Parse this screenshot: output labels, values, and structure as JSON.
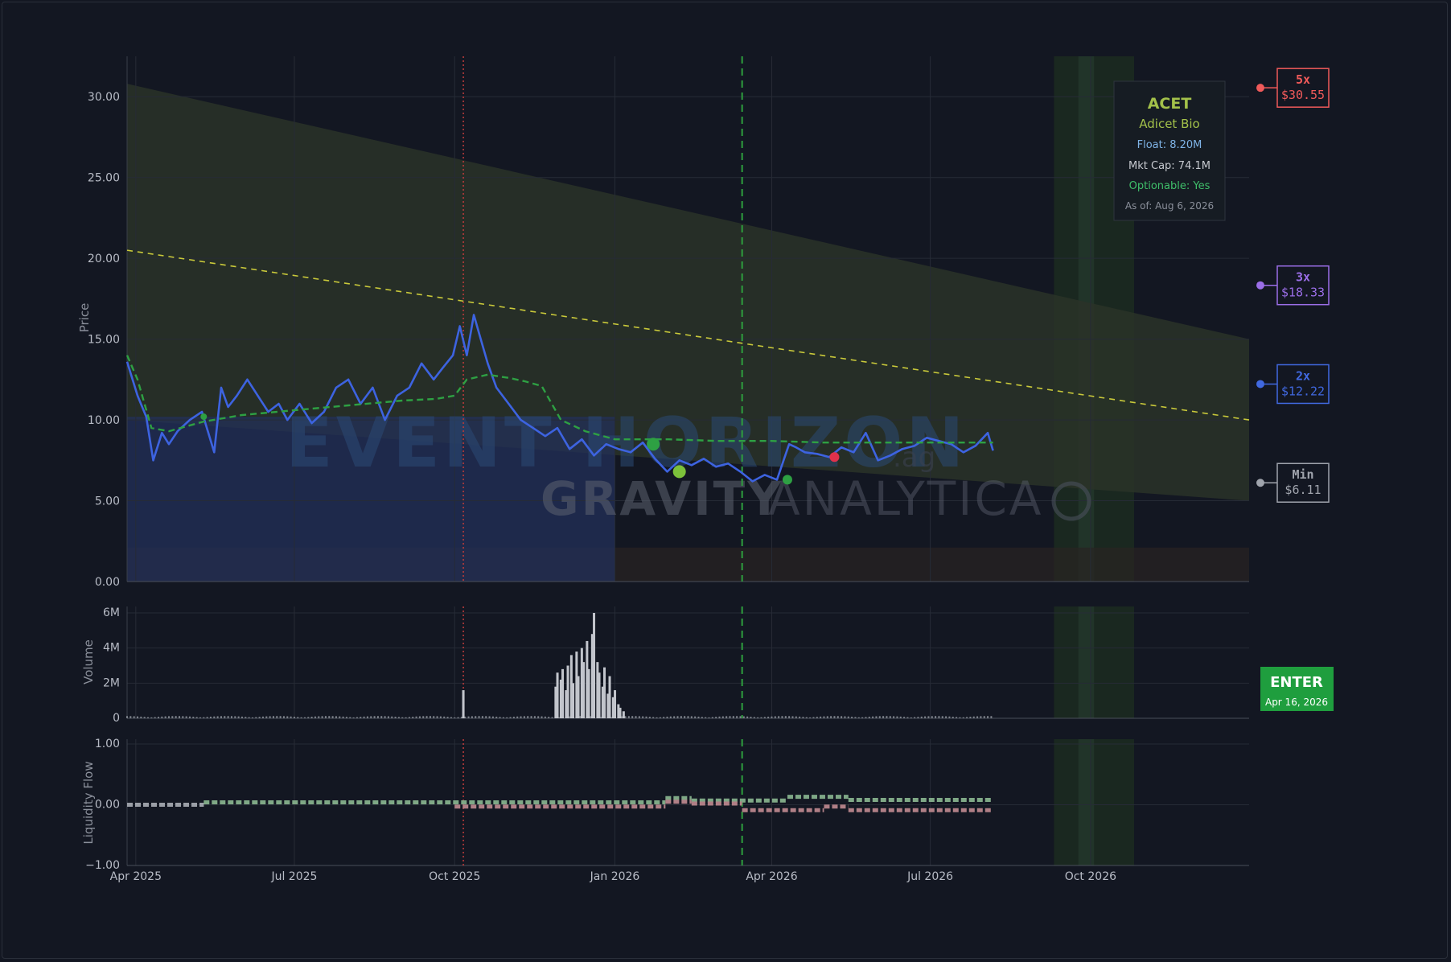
{
  "chart_data": {
    "type": "line",
    "ticker": "ACET",
    "company": "Adicet Bio",
    "float_label": "Float: 8.20M",
    "mktcap_label": "Mkt Cap: 74.1M",
    "optionable_label": "Optionable: Yes",
    "asof_label": "As of: Aug 6, 2026",
    "watermark": {
      "line1": "EVENT HORIZON",
      "suffix": ".ag",
      "line2a": "GRAVITY",
      "line2b": "ANALYTICA"
    },
    "x_ticks": [
      "Apr 2025",
      "Jul 2025",
      "Oct 2025",
      "Jan 2026",
      "Apr 2026",
      "Jul 2026",
      "Oct 2026"
    ],
    "x_range": [
      "2025-03-27",
      "2026-12-31"
    ],
    "price_panel": {
      "ylabel": "Price",
      "ylim": [
        0,
        32.5
      ],
      "yticks": [
        "0.00",
        "5.00",
        "10.00",
        "15.00",
        "20.00",
        "25.00",
        "30.00"
      ],
      "price_dates": [
        "2025-03-27",
        "2025-04-02",
        "2025-04-07",
        "2025-04-11",
        "2025-04-16",
        "2025-04-20",
        "2025-04-25",
        "2025-05-02",
        "2025-05-09",
        "2025-05-16",
        "2025-05-20",
        "2025-05-24",
        "2025-05-29",
        "2025-06-04",
        "2025-06-10",
        "2025-06-16",
        "2025-06-22",
        "2025-06-27",
        "2025-07-04",
        "2025-07-11",
        "2025-07-18",
        "2025-07-25",
        "2025-08-01",
        "2025-08-08",
        "2025-08-15",
        "2025-08-22",
        "2025-08-29",
        "2025-09-05",
        "2025-09-12",
        "2025-09-19",
        "2025-09-24",
        "2025-09-30",
        "2025-10-04",
        "2025-10-08",
        "2025-10-12",
        "2025-10-16",
        "2025-10-20",
        "2025-10-25",
        "2025-11-01",
        "2025-11-08",
        "2025-11-15",
        "2025-11-22",
        "2025-11-29",
        "2025-12-06",
        "2025-12-13",
        "2025-12-20",
        "2025-12-27",
        "2026-01-03",
        "2026-01-10",
        "2026-01-17",
        "2026-01-24",
        "2026-01-31",
        "2026-02-07",
        "2026-02-14",
        "2026-02-21",
        "2026-02-28",
        "2026-03-07",
        "2026-03-14",
        "2026-03-21",
        "2026-03-28",
        "2026-04-04",
        "2026-04-11",
        "2026-04-15",
        "2026-04-20",
        "2026-04-27",
        "2026-05-04",
        "2026-05-11",
        "2026-05-18",
        "2026-05-25",
        "2026-06-01",
        "2026-06-08",
        "2026-06-15",
        "2026-06-22",
        "2026-06-29",
        "2026-07-06",
        "2026-07-13",
        "2026-07-20",
        "2026-07-27",
        "2026-08-03",
        "2026-08-06"
      ],
      "price_values": [
        13.6,
        11.5,
        10.2,
        7.5,
        9.2,
        8.5,
        9.3,
        10.0,
        10.5,
        8.0,
        12.0,
        10.8,
        11.5,
        12.5,
        11.5,
        10.5,
        11.0,
        10.0,
        11.0,
        9.8,
        10.5,
        12.0,
        12.5,
        11.0,
        12.0,
        10.0,
        11.5,
        12.0,
        13.5,
        12.5,
        13.2,
        14.0,
        15.8,
        14.0,
        16.5,
        15.0,
        13.5,
        12.0,
        11.0,
        10.0,
        9.5,
        9.0,
        9.5,
        8.2,
        8.8,
        7.8,
        8.5,
        8.2,
        8.0,
        8.6,
        7.6,
        6.8,
        7.5,
        7.2,
        7.6,
        7.1,
        7.3,
        6.8,
        6.2,
        6.6,
        6.3,
        8.5,
        8.3,
        8.0,
        7.9,
        7.7,
        8.3,
        8.0,
        9.2,
        7.5,
        7.8,
        8.2,
        8.4,
        8.9,
        8.7,
        8.5,
        8.0,
        8.4,
        9.2,
        8.1
      ],
      "ma_dates": [
        "2025-03-27",
        "2025-04-02",
        "2025-04-10",
        "2025-04-20",
        "2025-05-10",
        "2025-06-01",
        "2025-07-01",
        "2025-08-01",
        "2025-09-01",
        "2025-09-20",
        "2025-10-01",
        "2025-10-08",
        "2025-10-20",
        "2025-11-01",
        "2025-11-10",
        "2025-11-20",
        "2025-12-01",
        "2025-12-15",
        "2026-01-01",
        "2026-02-01",
        "2026-03-01",
        "2026-04-01",
        "2026-05-01",
        "2026-06-01",
        "2026-07-01",
        "2026-08-06"
      ],
      "ma_values": [
        14.0,
        12.5,
        9.5,
        9.3,
        9.9,
        10.3,
        10.6,
        10.9,
        11.2,
        11.3,
        11.5,
        12.5,
        12.8,
        12.6,
        12.4,
        12.1,
        10.0,
        9.3,
        8.8,
        8.8,
        8.7,
        8.7,
        8.6,
        8.6,
        8.6,
        8.6
      ],
      "channel": {
        "upper": [
          30.8,
          15.0
        ],
        "lower": [
          10.0,
          5.0
        ],
        "mid": [
          20.5,
          10.0
        ]
      },
      "events": [
        {
          "date": "2025-05-10",
          "y": 10.2,
          "color": "#2ea043"
        },
        {
          "date": "2026-01-23",
          "y": 8.5,
          "color": "#2ea043"
        },
        {
          "date": "2026-02-07",
          "y": 6.8,
          "color": "#7cc13a"
        },
        {
          "date": "2026-04-10",
          "y": 6.3,
          "color": "#2ea043"
        },
        {
          "date": "2026-05-07",
          "y": 7.7,
          "color": "#e0314b"
        }
      ]
    },
    "levels": [
      {
        "label": "5x",
        "value": "$30.55",
        "y": 30.55,
        "color": "#f05a5a"
      },
      {
        "label": "3x",
        "value": "$18.33",
        "y": 18.33,
        "color": "#9b6ee8"
      },
      {
        "label": "2x",
        "value": "$12.22",
        "y": 12.22,
        "color": "#4169e1"
      },
      {
        "label": "Min",
        "value": "$6.11",
        "y": 6.11,
        "color": "#a0a4ad"
      }
    ],
    "volume_panel": {
      "ylabel": "Volume",
      "ylim": [
        0,
        6
      ],
      "yticks": [
        "0",
        "2M",
        "4M",
        "6M"
      ],
      "spike": {
        "date": "2025-10-06",
        "value": 1.6
      },
      "cluster_start": "2025-11-28",
      "cluster_values": [
        1.8,
        2.6,
        2.2,
        2.8,
        1.6,
        3.0,
        3.6,
        2.0,
        3.8,
        2.4,
        4.0,
        3.2,
        4.4,
        2.8,
        4.8,
        6.0,
        3.2,
        2.6,
        1.8,
        2.9,
        1.4,
        2.4,
        1.2,
        1.6,
        0.8,
        0.6,
        0.4
      ]
    },
    "liquidity_panel": {
      "ylabel": "Liquidity Flow",
      "ylim": [
        -1,
        1
      ],
      "yticks": [
        "−1.00",
        "0.00",
        "1.00"
      ],
      "upper_steps": [
        [
          "2025-03-27",
          "2025-05-10",
          0.0
        ],
        [
          "2025-05-10",
          "2026-01-30",
          0.04
        ],
        [
          "2026-01-30",
          "2026-02-14",
          0.11
        ],
        [
          "2026-02-14",
          "2026-04-10",
          0.07
        ],
        [
          "2026-04-10",
          "2026-05-15",
          0.13
        ],
        [
          "2026-05-15",
          "2026-08-06",
          0.08
        ]
      ],
      "lower_steps": [
        [
          "2025-10-01",
          "2026-01-30",
          -0.03
        ],
        [
          "2026-01-30",
          "2026-02-14",
          0.05
        ],
        [
          "2026-02-14",
          "2026-03-15",
          0.02
        ],
        [
          "2026-03-15",
          "2026-05-01",
          -0.09
        ],
        [
          "2026-05-01",
          "2026-05-15",
          -0.03
        ],
        [
          "2026-05-15",
          "2026-08-06",
          -0.09
        ]
      ]
    },
    "markers": {
      "red_dotted": "2025-10-06",
      "green_dashed": "2026-03-15",
      "shade_start": "2026-09-10",
      "shade_end": "2026-10-26",
      "shade_inner": "2026-09-24",
      "shade_inner_end": "2026-10-03",
      "blue_area_end": "2026-01-01"
    },
    "enter": {
      "label": "ENTER",
      "date": "Apr 16, 2026"
    }
  },
  "colors": {
    "price": "#3d63e0",
    "ma": "#2ea043",
    "mid": "#c9c93a",
    "channel": "#2c3a2a",
    "enter": "#1f9e3e"
  }
}
